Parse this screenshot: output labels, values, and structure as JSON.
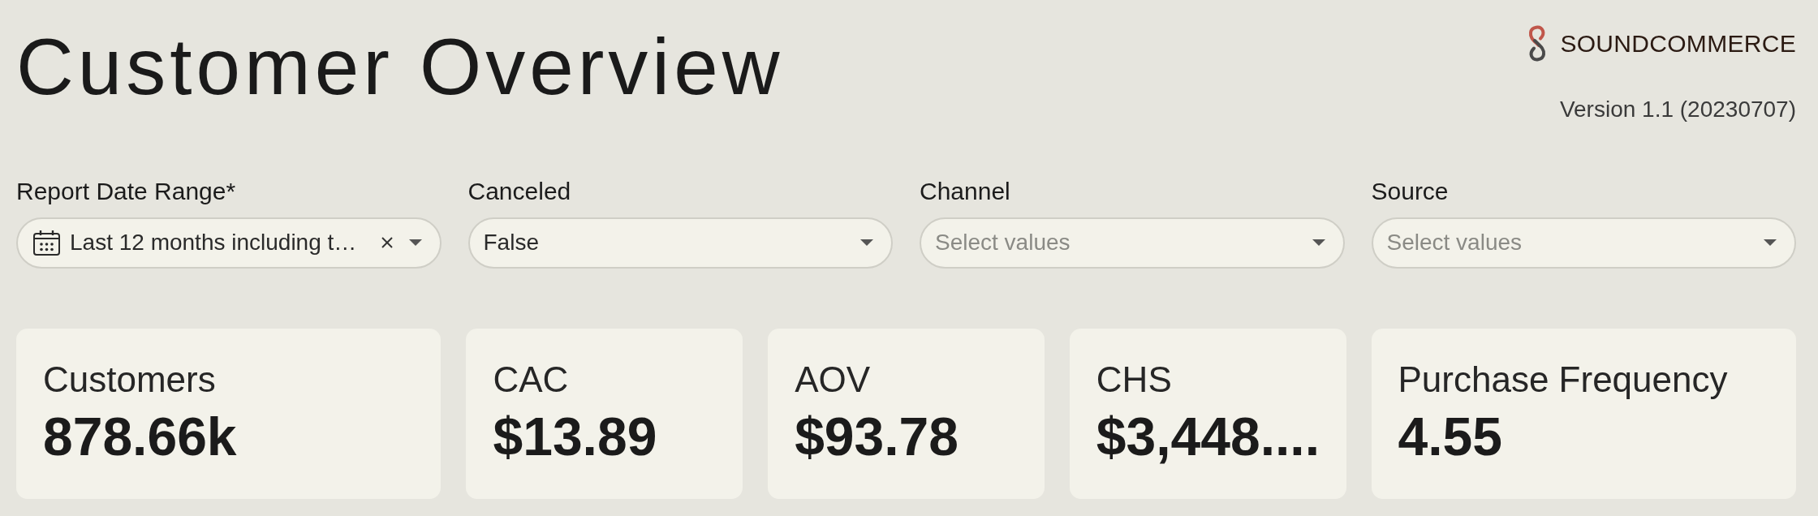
{
  "header": {
    "title": "Customer Overview",
    "logo": {
      "text": "SOUNDCOMMERCE"
    },
    "version": "Version 1.1 (20230707)"
  },
  "filters": [
    {
      "label": "Report Date Range*",
      "kind": "date",
      "value": "Last 12 months including t…",
      "clearable": true
    },
    {
      "label": "Canceled",
      "kind": "select",
      "value": "False",
      "clearable": false
    },
    {
      "label": "Channel",
      "kind": "select",
      "placeholder": "Select values",
      "clearable": false
    },
    {
      "label": "Source",
      "kind": "select",
      "placeholder": "Select values",
      "clearable": false
    }
  ],
  "metrics": [
    {
      "label": "Customers",
      "value": "878.66k"
    },
    {
      "label": "CAC",
      "value": "$13.89"
    },
    {
      "label": "AOV",
      "value": "$93.78"
    },
    {
      "label": "CHS",
      "value": "$3,448...."
    },
    {
      "label": "Purchase Frequency",
      "value": "4.55"
    }
  ]
}
